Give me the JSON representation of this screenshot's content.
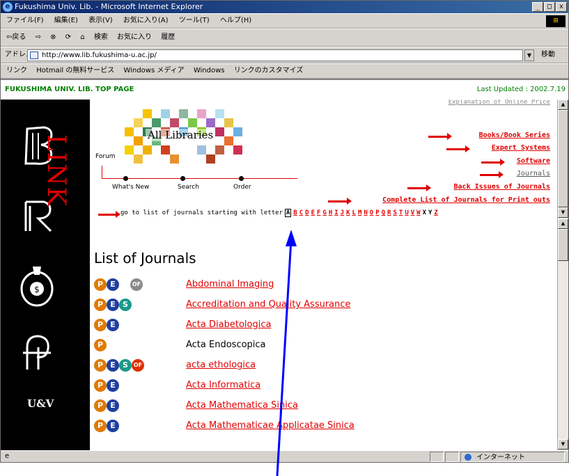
{
  "window": {
    "title": "Fukushima Univ. Lib. - Microsoft Internet Explorer",
    "btn_min": "_",
    "btn_max": "□",
    "btn_close": "x"
  },
  "menubar": {
    "items": [
      "ファイル(F)",
      "編集(E)",
      "表示(V)",
      "お気に入り(A)",
      "ツール(T)",
      "ヘルプ(H)"
    ]
  },
  "toolbar": {
    "back": "⇦戻る",
    "forward": "⇨",
    "stop": "⊗",
    "refresh": "⟳",
    "home": "⌂",
    "search": "検索",
    "favorites": "お気に入り",
    "history": "履歴"
  },
  "addressbar": {
    "label": "アドレス(D)",
    "url": "http://www.lib.fukushima-u.ac.jp/",
    "go": "移動"
  },
  "linksbar": {
    "label": "リンク",
    "items": [
      "Hotmail の無料サービス",
      "Windows メディア",
      "Windows",
      "リンクのカスタマイズ"
    ]
  },
  "page": {
    "header_left": "FUKUSHIMA UNIV. LIB. TOP PAGE",
    "header_right": "Last Updated : 2002.7.19",
    "logo_text": "All Libraries",
    "forum": "Forum",
    "link_vertical": "LINK",
    "nav": [
      "What's New",
      "Search",
      "Order"
    ],
    "uv": "U&V",
    "right_links": [
      {
        "label": "Explanation of Online Price",
        "style": "cut"
      },
      {
        "label": "Books/Book Series",
        "style": "link"
      },
      {
        "label": "Expert Systems",
        "style": "link"
      },
      {
        "label": "Software",
        "style": "link"
      },
      {
        "label": "Journals",
        "style": "plain"
      },
      {
        "label": "Back Issues of Journals",
        "style": "link"
      },
      {
        "label": "Complete List of Journals for Print outs",
        "style": "link"
      }
    ],
    "go_text": "go to list of journals starting with letter",
    "letters": [
      "A",
      "B",
      "C",
      "D",
      "E",
      "F",
      "G",
      "H",
      "I",
      "J",
      "K",
      "L",
      "M",
      "N",
      "O",
      "P",
      "Q",
      "R",
      "S",
      "T",
      "U",
      "V",
      "W",
      "X",
      "Y",
      "Z"
    ],
    "current_letter": "A",
    "plain_letters": [
      "X",
      "Y"
    ],
    "list_title": "List of Journals",
    "journals": [
      {
        "title": "Abdominal Imaging",
        "badges": [
          "P",
          "E",
          "OFg"
        ],
        "link": true
      },
      {
        "title": "Accreditation and Quality Assurance",
        "badges": [
          "P",
          "E",
          "S"
        ],
        "link": true
      },
      {
        "title": "Acta Diabetologica",
        "badges": [
          "P",
          "E"
        ],
        "link": true
      },
      {
        "title": "Acta Endoscopica",
        "badges": [
          "P"
        ],
        "link": false
      },
      {
        "title": "acta ethologica",
        "badges": [
          "P",
          "E",
          "S",
          "OF"
        ],
        "link": true
      },
      {
        "title": "Acta Informatica",
        "badges": [
          "P",
          "E"
        ],
        "link": true
      },
      {
        "title": "Acta Mathematica Sinica",
        "badges": [
          "P",
          "E"
        ],
        "link": true
      },
      {
        "title": "Acta Mathematicae Applicatae Sinica",
        "badges": [
          "P",
          "E"
        ],
        "link": true
      }
    ]
  },
  "statusbar": {
    "zone": "インターネット"
  },
  "colors": {
    "link_red": "#e00000",
    "header_green": "#008000",
    "pointer_blue": "#0000ff"
  }
}
